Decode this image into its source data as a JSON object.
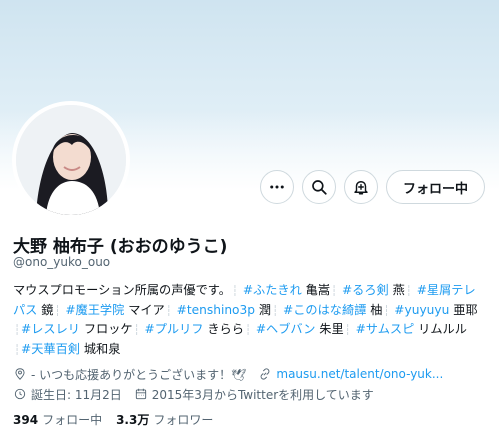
{
  "profile": {
    "name": "大野 柚布子 (おおのゆうこ)",
    "handle": "@ono_yuko_ouo",
    "follow_button": "フォロー中"
  },
  "bio": {
    "line1": {
      "t1": "マウスプロモーション所属の声優です。",
      "t2": "#ふたきれ",
      "t3": "亀嵩",
      "t4": "#るろ剣",
      "t5": "燕",
      "t6": "#星屑テレ"
    },
    "line2": {
      "t1": "パス",
      "t2": "鏡",
      "t3": "#魔王学院",
      "t4": "マイア",
      "t5": "#tenshino3p",
      "t6": "潤",
      "t7": "#このはな綺譚",
      "t8": "柚",
      "t9": "#yuyuyu",
      "t10": "亜耶"
    },
    "line3": {
      "t1": "#レスレリ",
      "t2": "フロッケ",
      "t3": "#プルリフ",
      "t4": "きらら",
      "t5": "#ヘブバン",
      "t6": "朱里",
      "t7": "#サムスピ",
      "t8": "リムルル"
    },
    "line4": {
      "t1": "#天華百剣",
      "t2": "城和泉"
    },
    "separator": "┆",
    "accent_color": "#1d9bf0"
  },
  "meta": {
    "location": "- いつも応援ありがとうございます！🕊",
    "website": "mausu.net/talent/ono-yuk...",
    "birthday": "誕生日: 11月2日",
    "joined": "2015年3月からTwitterを利用しています",
    "icons": [
      "location-icon",
      "link-icon",
      "birthday-icon",
      "calendar-icon"
    ]
  },
  "stats": {
    "following_count": "394",
    "following_label": "フォロー中",
    "followers_count": "3.3万",
    "followers_label": "フォロワー"
  }
}
